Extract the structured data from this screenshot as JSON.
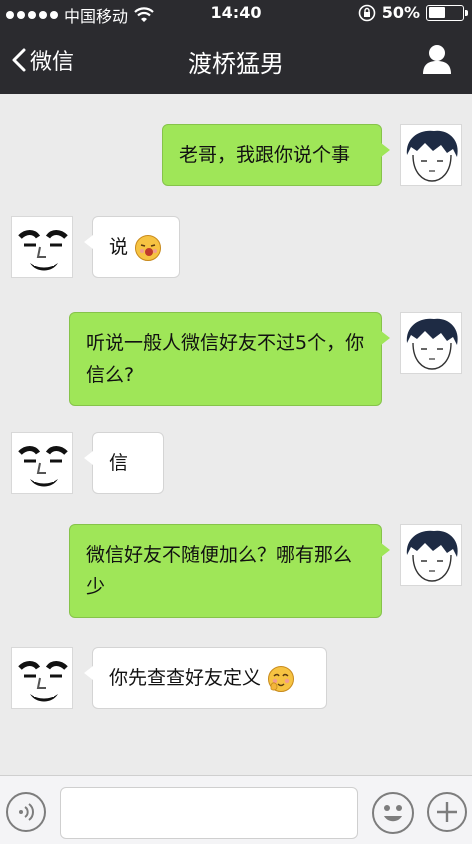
{
  "status_bar": {
    "carrier": "中国移动",
    "time": "14:40",
    "battery_text": "50%",
    "battery_level": 0.5
  },
  "nav": {
    "back_label": "微信",
    "title": "渡桥猛男"
  },
  "messages": [
    {
      "side": "out",
      "text": "老哥，我跟你说个事"
    },
    {
      "side": "in",
      "text": "说",
      "emoji": "laughing-emoji"
    },
    {
      "side": "out",
      "text": "听说一般人微信好友不过5个，你信么?"
    },
    {
      "side": "in",
      "text": "信"
    },
    {
      "side": "out",
      "text": "微信好友不随便加么？哪有那么少"
    },
    {
      "side": "in",
      "text": "你先查查好友定义",
      "emoji": "blushing-emoji"
    }
  ],
  "input_bar": {
    "text_value": ""
  },
  "colors": {
    "header_bg": "#2b2b2f",
    "chat_bg": "#ebebeb",
    "outgoing_bubble": "#9fe658",
    "incoming_bubble": "#ffffff"
  }
}
